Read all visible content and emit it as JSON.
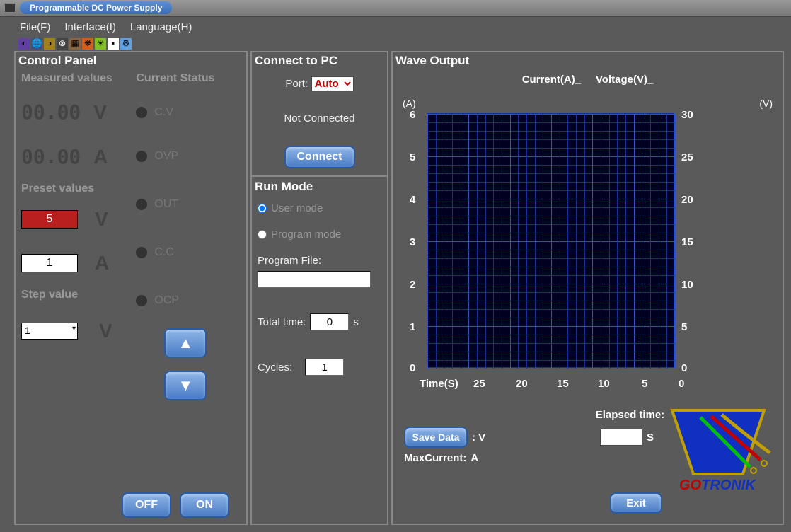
{
  "window": {
    "title": "Programmable DC Power Supply"
  },
  "menu": {
    "file": "File(F)",
    "interface": "Interface(I)",
    "language": "Language(H)"
  },
  "panels": {
    "control": {
      "title": "Control Panel",
      "measured_label": "Measured values",
      "status_label": "Current Status",
      "voltage_reading": "00.00",
      "voltage_unit": "V",
      "current_reading": "00.00",
      "current_unit": "A",
      "status_cv": "C.V",
      "status_ovp": "OVP",
      "status_out": "OUT",
      "status_cc": "C.C",
      "status_ocp": "OCP",
      "preset_label": "Preset values",
      "preset_voltage": "5",
      "preset_voltage_unit": "V",
      "preset_current": "1",
      "preset_current_unit": "A",
      "step_label": "Step value",
      "step_value": "1",
      "step_unit": "V",
      "off_btn": "OFF",
      "on_btn": "ON"
    },
    "connect": {
      "title": "Connect to PC",
      "port_label": "Port:",
      "port_value": "Auto",
      "status": "Not Connected",
      "connect_btn": "Connect"
    },
    "runmode": {
      "title": "Run Mode",
      "user_mode": "User mode",
      "program_mode": "Program mode",
      "program_file_label": "Program File:",
      "program_file_value": "",
      "total_time_label": "Total time:",
      "total_time_value": "0",
      "total_time_unit": "s",
      "cycles_label": "Cycles:",
      "cycles_value": "1"
    },
    "wave": {
      "title": "Wave Output",
      "legend_current": "Current(A)_",
      "legend_voltage": "Voltage(V)_",
      "axis_a": "(A)",
      "axis_v": "(V)",
      "time_label": "Time(S)",
      "elapsed_label": "Elapsed time:",
      "elapsed_value": "",
      "elapsed_unit": "S",
      "save_btn": "Save Data",
      "colon_v": ": V",
      "maxcurrent_label": "MaxCurrent:",
      "maxcurrent_a": "A",
      "exit_btn": "Exit"
    }
  },
  "chart_data": {
    "type": "line",
    "title": "",
    "x_label": "Time(S)",
    "x_ticks": [
      25,
      20,
      15,
      10,
      5,
      0
    ],
    "left_axis": {
      "label": "(A)",
      "ticks": [
        0,
        1,
        2,
        3,
        4,
        5,
        6
      ],
      "range": [
        0,
        6
      ]
    },
    "right_axis": {
      "label": "(V)",
      "ticks": [
        0,
        5,
        10,
        15,
        20,
        25,
        30
      ],
      "range": [
        0,
        30
      ]
    },
    "series": [
      {
        "name": "Current(A)",
        "axis": "left",
        "values": []
      },
      {
        "name": "Voltage(V)",
        "axis": "right",
        "values": []
      }
    ]
  },
  "brand": "GOTRONIK"
}
